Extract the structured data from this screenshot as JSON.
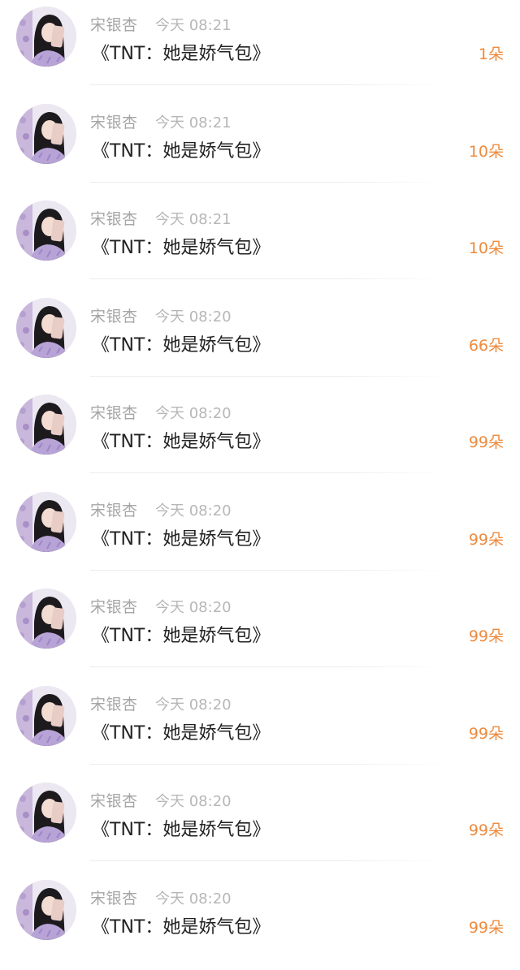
{
  "gift_list": {
    "items": [
      {
        "user": "宋银杏",
        "time": "今天 08:21",
        "title": "《TNT：她是娇气包》",
        "count": "1朵"
      },
      {
        "user": "宋银杏",
        "time": "今天 08:21",
        "title": "《TNT：她是娇气包》",
        "count": "10朵"
      },
      {
        "user": "宋银杏",
        "time": "今天 08:21",
        "title": "《TNT：她是娇气包》",
        "count": "10朵"
      },
      {
        "user": "宋银杏",
        "time": "今天 08:20",
        "title": "《TNT：她是娇气包》",
        "count": "66朵"
      },
      {
        "user": "宋银杏",
        "time": "今天 08:20",
        "title": "《TNT：她是娇气包》",
        "count": "99朵"
      },
      {
        "user": "宋银杏",
        "time": "今天 08:20",
        "title": "《TNT：她是娇气包》",
        "count": "99朵"
      },
      {
        "user": "宋银杏",
        "time": "今天 08:20",
        "title": "《TNT：她是娇气包》",
        "count": "99朵"
      },
      {
        "user": "宋银杏",
        "time": "今天 08:20",
        "title": "《TNT：她是娇气包》",
        "count": "99朵"
      },
      {
        "user": "宋银杏",
        "time": "今天 08:20",
        "title": "《TNT：她是娇气包》",
        "count": "99朵"
      },
      {
        "user": "宋银杏",
        "time": "今天 08:20",
        "title": "《TNT：她是娇气包》",
        "count": "99朵"
      }
    ]
  },
  "colors": {
    "count_accent": "#ee8a3d",
    "meta_text": "#a6a6a6",
    "title_text": "#222222"
  },
  "icons": {
    "avatar": "user-avatar-photo"
  }
}
